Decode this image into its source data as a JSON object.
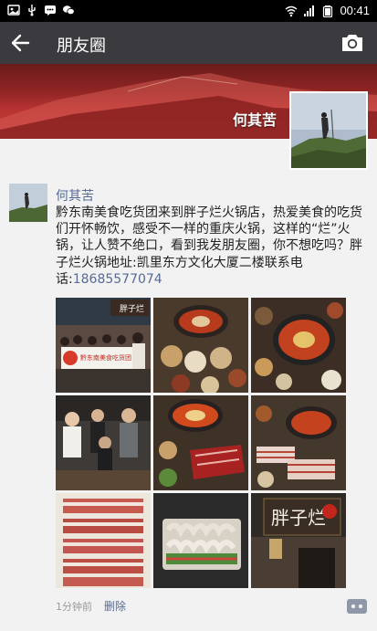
{
  "status_bar": {
    "time": "00:41",
    "left_icons": [
      "gallery-icon",
      "usb-icon",
      "message-icon",
      "wechat-icon"
    ],
    "right_icons": [
      "wifi-icon",
      "signal-icon",
      "battery-icon"
    ]
  },
  "nav": {
    "title": "朋友圈",
    "back_icon": "arrow-left-icon",
    "camera_icon": "camera-icon"
  },
  "cover": {
    "username": "何其苦"
  },
  "post": {
    "author": "何其苦",
    "text": "黔东南美食吃货团来到胖子烂火锅店，热爱美食的吃货们开怀畅饮，感受不一样的重庆火锅，这样的“烂”火锅，让人赞不绝口，看到我发朋友圈，你不想吃吗？胖子烂火锅地址:凯里东方文化大厦二楼联系电话:",
    "phone": "18685577074",
    "time": "1分钟前",
    "delete_label": "删除",
    "banner_text": "黔东南美食吃货团",
    "sign_text": "胖子烂",
    "colors": {
      "link": "#576b95",
      "nav_bg": "#3a3a3f",
      "cover_red": "#b83232"
    }
  }
}
